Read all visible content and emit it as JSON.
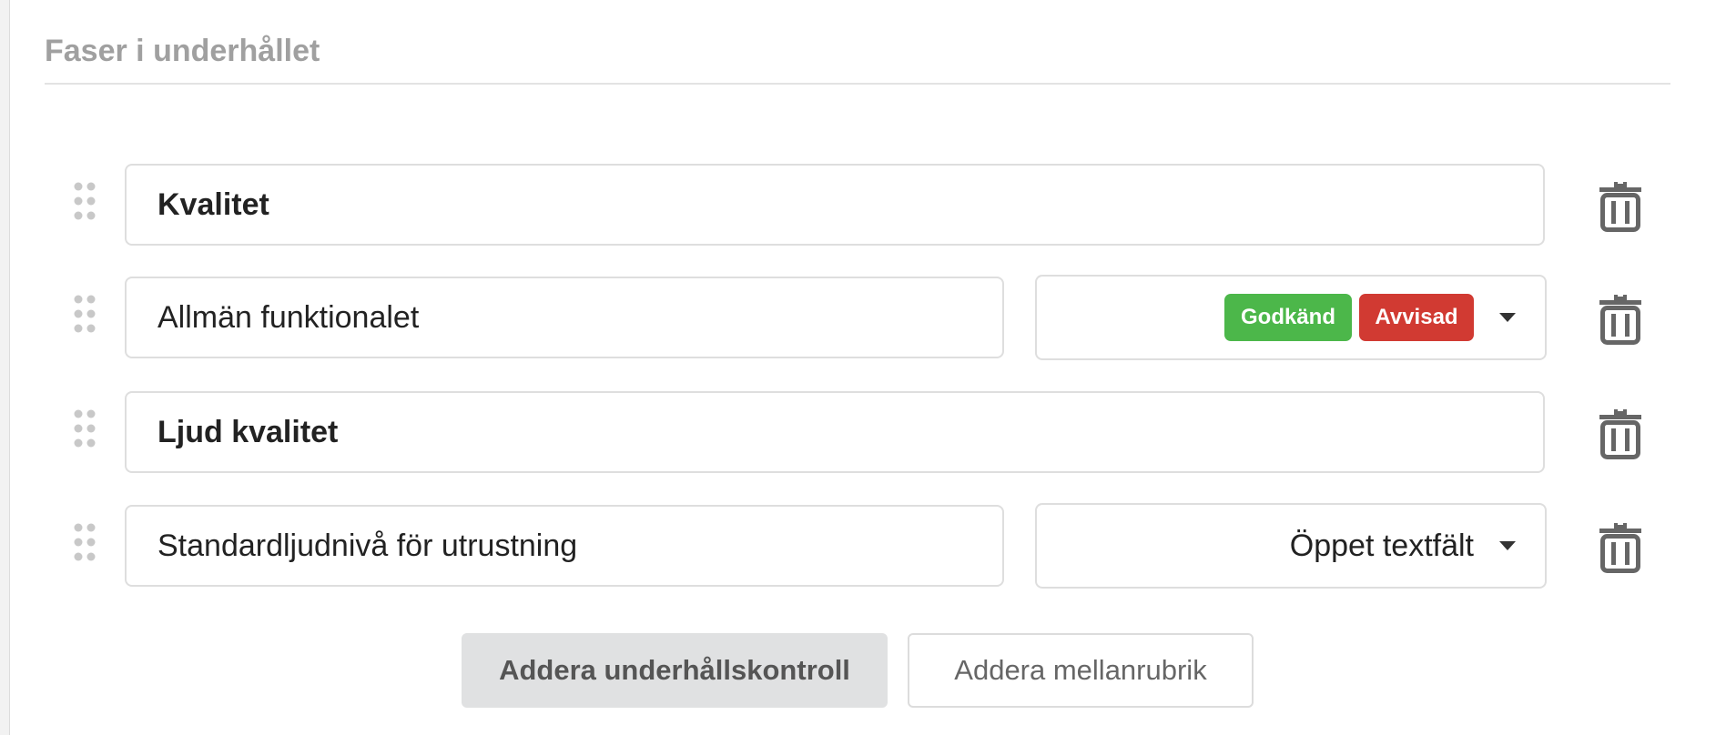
{
  "section": {
    "title": "Faser i underhållet"
  },
  "rows": [
    {
      "type": "heading",
      "text": "Kvalitet"
    },
    {
      "type": "control",
      "text": "Allmän funktionalet",
      "answer_type": "badges",
      "badges": [
        "Godkänd",
        "Avvisad"
      ]
    },
    {
      "type": "heading",
      "text": "Ljud kvalitet"
    },
    {
      "type": "control",
      "text": "Standardljudnivå för utrustning",
      "answer_type": "select",
      "selected": "Öppet textfält"
    }
  ],
  "icons": {
    "drag": "drag-handle-icon",
    "delete": "trash-icon",
    "dropdown": "chevron-down-icon"
  },
  "colors": {
    "approved": "#4cb74a",
    "rejected": "#d13a32"
  },
  "buttons": {
    "add_control": "Addera underhållskontroll",
    "add_subheading": "Addera mellanrubrik"
  }
}
